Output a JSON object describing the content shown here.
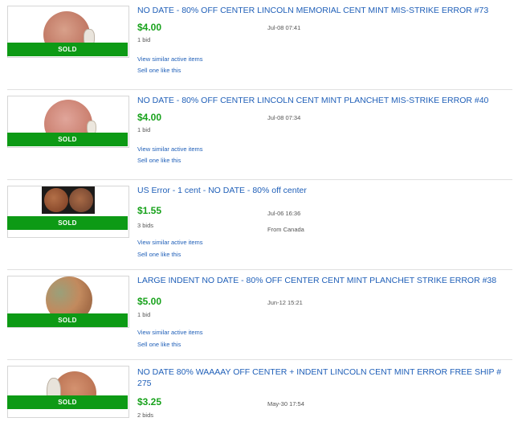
{
  "listings": [
    {
      "title": "NO DATE - 80% OFF CENTER LINCOLN MEMORIAL CENT MINT MIS-STRIKE ERROR #73",
      "price": "$4.00",
      "bids": "1 bid",
      "date": "Jul-08 07:41",
      "from": "",
      "sold_label": "SOLD",
      "view_similar": "View similar active items",
      "sell_one": "Sell one like this"
    },
    {
      "title": "NO DATE - 80% OFF CENTER LINCOLN CENT MINT PLANCHET MIS-STRIKE ERROR #40",
      "price": "$4.00",
      "bids": "1 bid",
      "date": "Jul-08 07:34",
      "from": "",
      "sold_label": "SOLD",
      "view_similar": "View similar active items",
      "sell_one": "Sell one like this"
    },
    {
      "title": "US Error - 1 cent - NO DATE - 80% off center",
      "price": "$1.55",
      "bids": "3 bids",
      "date": "Jul-06 16:36",
      "from": "From Canada",
      "sold_label": "SOLD",
      "view_similar": "View similar active items",
      "sell_one": "Sell one like this"
    },
    {
      "title": "LARGE INDENT NO DATE - 80% OFF CENTER CENT MINT PLANCHET STRIKE ERROR #38",
      "price": "$5.00",
      "bids": "1 bid",
      "date": "Jun-12 15:21",
      "from": "",
      "sold_label": "SOLD",
      "view_similar": "View similar active items",
      "sell_one": "Sell one like this"
    },
    {
      "title": "NO DATE 80% WAAAAY OFF CENTER + INDENT LINCOLN CENT MINT ERROR FREE SHIP # 275",
      "price": "$3.25",
      "bids": "2 bids",
      "date": "May-30 17:54",
      "from": "",
      "sold_label": "SOLD",
      "view_similar": "",
      "sell_one": ""
    }
  ],
  "colors": {
    "title_link": "#1f5fb8",
    "price": "#18a21c",
    "sold_bar": "#0d9a15"
  }
}
